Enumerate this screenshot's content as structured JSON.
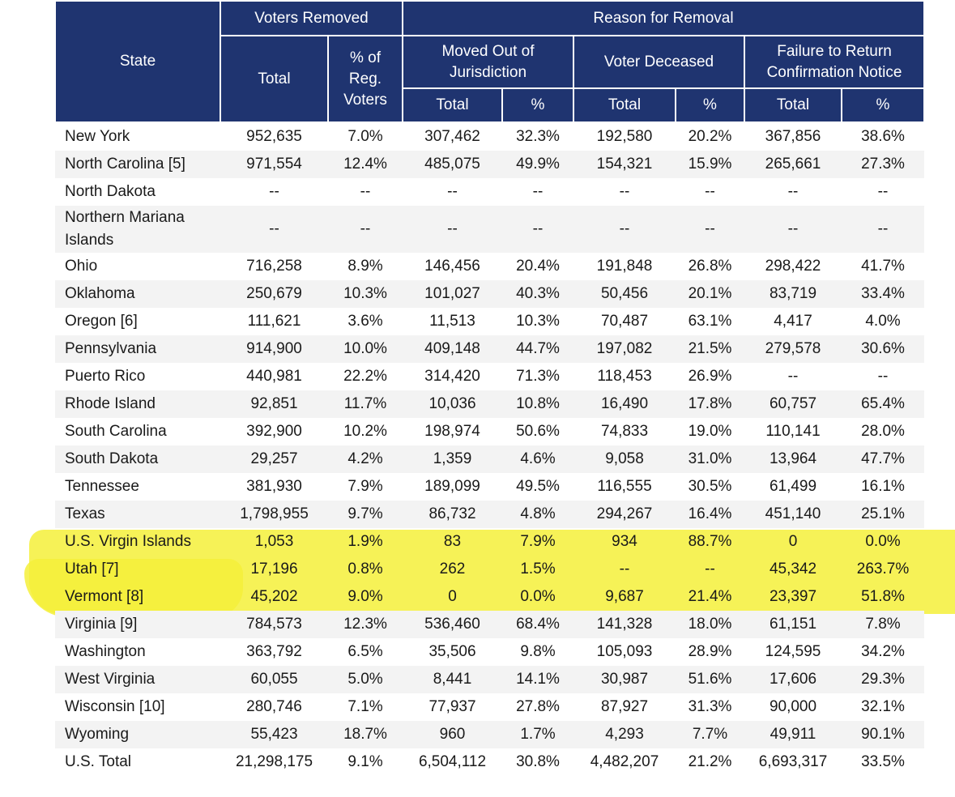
{
  "header": {
    "state": "State",
    "voters_removed": "Voters Removed",
    "reason_for_removal": "Reason for Removal",
    "total": "Total",
    "pct_reg_voters": "% of Reg. Voters",
    "moved": "Moved Out of Jurisdiction",
    "deceased": "Voter Deceased",
    "failure": "Failure to Return Confirmation Notice",
    "sub_total": "Total",
    "sub_pct": "%"
  },
  "rows": [
    [
      "New York",
      "952,635",
      "7.0%",
      "307,462",
      "32.3%",
      "192,580",
      "20.2%",
      "367,856",
      "38.6%"
    ],
    [
      "North Carolina [5]",
      "971,554",
      "12.4%",
      "485,075",
      "49.9%",
      "154,321",
      "15.9%",
      "265,661",
      "27.3%"
    ],
    [
      "North Dakota",
      "--",
      "--",
      "--",
      "--",
      "--",
      "--",
      "--",
      "--"
    ],
    [
      "Northern Mariana Islands",
      "--",
      "--",
      "--",
      "--",
      "--",
      "--",
      "--",
      "--"
    ],
    [
      "Ohio",
      "716,258",
      "8.9%",
      "146,456",
      "20.4%",
      "191,848",
      "26.8%",
      "298,422",
      "41.7%"
    ],
    [
      "Oklahoma",
      "250,679",
      "10.3%",
      "101,027",
      "40.3%",
      "50,456",
      "20.1%",
      "83,719",
      "33.4%"
    ],
    [
      "Oregon [6]",
      "111,621",
      "3.6%",
      "11,513",
      "10.3%",
      "70,487",
      "63.1%",
      "4,417",
      "4.0%"
    ],
    [
      "Pennsylvania",
      "914,900",
      "10.0%",
      "409,148",
      "44.7%",
      "197,082",
      "21.5%",
      "279,578",
      "30.6%"
    ],
    [
      "Puerto Rico",
      "440,981",
      "22.2%",
      "314,420",
      "71.3%",
      "118,453",
      "26.9%",
      "--",
      "--"
    ],
    [
      "Rhode Island",
      "92,851",
      "11.7%",
      "10,036",
      "10.8%",
      "16,490",
      "17.8%",
      "60,757",
      "65.4%"
    ],
    [
      "South Carolina",
      "392,900",
      "10.2%",
      "198,974",
      "50.6%",
      "74,833",
      "19.0%",
      "110,141",
      "28.0%"
    ],
    [
      "South Dakota",
      "29,257",
      "4.2%",
      "1,359",
      "4.6%",
      "9,058",
      "31.0%",
      "13,964",
      "47.7%"
    ],
    [
      "Tennessee",
      "381,930",
      "7.9%",
      "189,099",
      "49.5%",
      "116,555",
      "30.5%",
      "61,499",
      "16.1%"
    ],
    [
      "Texas",
      "1,798,955",
      "9.7%",
      "86,732",
      "4.8%",
      "294,267",
      "16.4%",
      "451,140",
      "25.1%"
    ],
    [
      "U.S. Virgin Islands",
      "1,053",
      "1.9%",
      "83",
      "7.9%",
      "934",
      "88.7%",
      "0",
      "0.0%"
    ],
    [
      "Utah [7]",
      "17,196",
      "0.8%",
      "262",
      "1.5%",
      "--",
      "--",
      "45,342",
      "263.7%"
    ],
    [
      "Vermont [8]",
      "45,202",
      "9.0%",
      "0",
      "0.0%",
      "9,687",
      "21.4%",
      "23,397",
      "51.8%"
    ],
    [
      "Virginia [9]",
      "784,573",
      "12.3%",
      "536,460",
      "68.4%",
      "141,328",
      "18.0%",
      "61,151",
      "7.8%"
    ],
    [
      "Washington",
      "363,792",
      "6.5%",
      "35,506",
      "9.8%",
      "105,093",
      "28.9%",
      "124,595",
      "34.2%"
    ],
    [
      "West Virginia",
      "60,055",
      "5.0%",
      "8,441",
      "14.1%",
      "30,987",
      "51.6%",
      "17,606",
      "29.3%"
    ],
    [
      "Wisconsin [10]",
      "280,746",
      "7.1%",
      "77,937",
      "27.8%",
      "87,927",
      "31.3%",
      "90,000",
      "32.1%"
    ],
    [
      "Wyoming",
      "55,423",
      "18.7%",
      "960",
      "1.7%",
      "4,293",
      "7.7%",
      "49,911",
      "90.1%"
    ],
    [
      "U.S. Total",
      "21,298,175",
      "9.1%",
      "6,504,112",
      "30.8%",
      "4,482,207",
      "21.2%",
      "6,693,317",
      "33.5%"
    ]
  ],
  "highlighted_states": [
    "U.S. Virgin Islands",
    "Utah [7]",
    "Vermont [8]"
  ],
  "colors": {
    "header_bg": "#1f3470",
    "highlight": "#f5f03a",
    "stripe": "#f3f3f3"
  }
}
